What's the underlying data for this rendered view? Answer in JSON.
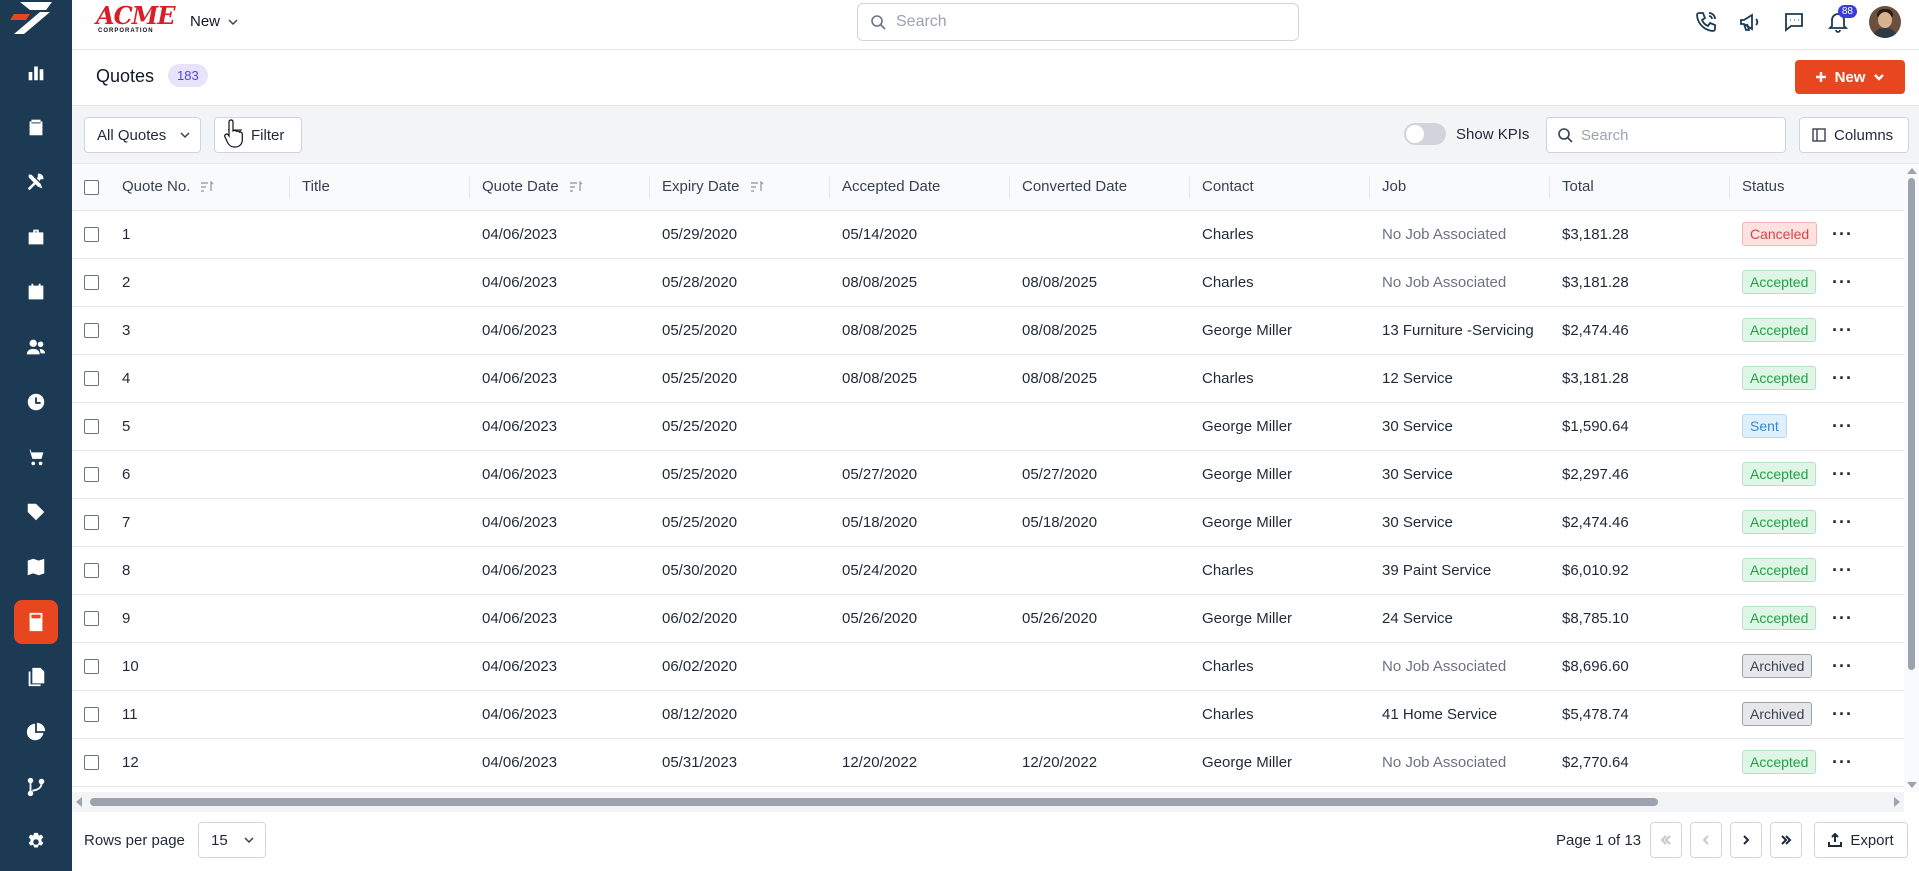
{
  "brand": {
    "logo_text": "ACME",
    "logo_subtext": "CORPORATION",
    "accent": "#e8461f",
    "sidebar_bg": "#1d3a55"
  },
  "topbar": {
    "new_menu_label": "New",
    "search_placeholder": "Search",
    "notifications_count": "88"
  },
  "sidebar": {
    "items": [
      {
        "icon": "bar-chart-icon"
      },
      {
        "icon": "clipboard-icon"
      },
      {
        "icon": "tools-icon"
      },
      {
        "icon": "briefcase-icon"
      },
      {
        "icon": "calendar-icon"
      },
      {
        "icon": "users-icon"
      },
      {
        "icon": "clock-icon"
      },
      {
        "icon": "cart-icon"
      },
      {
        "icon": "tag-icon"
      },
      {
        "icon": "map-icon"
      },
      {
        "icon": "calculator-icon",
        "active": true
      },
      {
        "icon": "documents-icon"
      },
      {
        "icon": "pie-chart-icon"
      },
      {
        "icon": "workflow-icon"
      },
      {
        "icon": "settings-icon"
      }
    ]
  },
  "header": {
    "title": "Quotes",
    "count": "183",
    "new_button": "New"
  },
  "toolbar": {
    "view_select": "All Quotes",
    "filter_label": "Filter",
    "kpi_label": "Show KPIs",
    "search_placeholder": "Search",
    "columns_label": "Columns"
  },
  "table": {
    "columns": [
      "Quote No.",
      "Title",
      "Quote Date",
      "Expiry Date",
      "Accepted Date",
      "Converted Date",
      "Contact",
      "Job",
      "Total",
      "Status"
    ],
    "rows": [
      {
        "no": "1",
        "title": "",
        "quote_date": "04/06/2023",
        "expiry": "05/29/2020",
        "accepted": "05/14/2020",
        "converted": "",
        "contact": "Charles",
        "job": "No Job Associated",
        "total": "$3,181.28",
        "status": "Canceled"
      },
      {
        "no": "2",
        "title": "",
        "quote_date": "04/06/2023",
        "expiry": "05/28/2020",
        "accepted": "08/08/2025",
        "converted": "08/08/2025",
        "contact": "Charles",
        "job": "No Job Associated",
        "total": "$3,181.28",
        "status": "Accepted"
      },
      {
        "no": "3",
        "title": "",
        "quote_date": "04/06/2023",
        "expiry": "05/25/2020",
        "accepted": "08/08/2025",
        "converted": "08/08/2025",
        "contact": "George Miller",
        "job": "13 Furniture -Servicing",
        "total": "$2,474.46",
        "status": "Accepted"
      },
      {
        "no": "4",
        "title": "",
        "quote_date": "04/06/2023",
        "expiry": "05/25/2020",
        "accepted": "08/08/2025",
        "converted": "08/08/2025",
        "contact": "Charles",
        "job": "12 Service",
        "total": "$3,181.28",
        "status": "Accepted"
      },
      {
        "no": "5",
        "title": "",
        "quote_date": "04/06/2023",
        "expiry": "05/25/2020",
        "accepted": "",
        "converted": "",
        "contact": "George Miller",
        "job": "30 Service",
        "total": "$1,590.64",
        "status": "Sent"
      },
      {
        "no": "6",
        "title": "",
        "quote_date": "04/06/2023",
        "expiry": "05/25/2020",
        "accepted": "05/27/2020",
        "converted": "05/27/2020",
        "contact": "George Miller",
        "job": "30 Service",
        "total": "$2,297.46",
        "status": "Accepted"
      },
      {
        "no": "7",
        "title": "",
        "quote_date": "04/06/2023",
        "expiry": "05/25/2020",
        "accepted": "05/18/2020",
        "converted": "05/18/2020",
        "contact": "George Miller",
        "job": "30 Service",
        "total": "$2,474.46",
        "status": "Accepted"
      },
      {
        "no": "8",
        "title": "",
        "quote_date": "04/06/2023",
        "expiry": "05/30/2020",
        "accepted": "05/24/2020",
        "converted": "",
        "contact": "Charles",
        "job": "39 Paint Service",
        "total": "$6,010.92",
        "status": "Accepted"
      },
      {
        "no": "9",
        "title": "",
        "quote_date": "04/06/2023",
        "expiry": "06/02/2020",
        "accepted": "05/26/2020",
        "converted": "05/26/2020",
        "contact": "George Miller",
        "job": "24 Service",
        "total": "$8,785.10",
        "status": "Accepted"
      },
      {
        "no": "10",
        "title": "",
        "quote_date": "04/06/2023",
        "expiry": "06/02/2020",
        "accepted": "",
        "converted": "",
        "contact": "Charles",
        "job": "No Job Associated",
        "total": "$8,696.60",
        "status": "Archived"
      },
      {
        "no": "11",
        "title": "",
        "quote_date": "04/06/2023",
        "expiry": "08/12/2020",
        "accepted": "",
        "converted": "",
        "contact": "Charles",
        "job": "41 Home Service",
        "total": "$5,478.74",
        "status": "Archived"
      },
      {
        "no": "12",
        "title": "",
        "quote_date": "04/06/2023",
        "expiry": "05/31/2023",
        "accepted": "12/20/2022",
        "converted": "12/20/2022",
        "contact": "George Miller",
        "job": "No Job Associated",
        "total": "$2,770.64",
        "status": "Accepted"
      }
    ]
  },
  "footer": {
    "rows_per_page_label": "Rows per page",
    "rows_per_page_value": "15",
    "page_info": "Page 1 of 13",
    "export_label": "Export"
  }
}
